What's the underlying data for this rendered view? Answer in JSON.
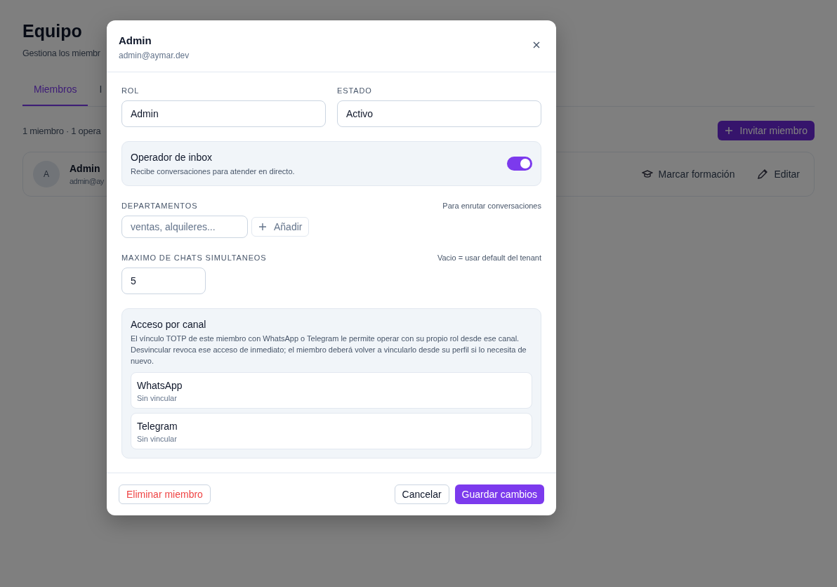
{
  "page": {
    "title": "Equipo",
    "subtitle": "Gestiona los miembr",
    "tabs": [
      {
        "label": "Miembros",
        "selected": true
      },
      {
        "label": "I",
        "selected": false
      }
    ],
    "summary": "1 miembro · 1 opera",
    "invite_button": "Invitar miembro",
    "member": {
      "avatar": "A",
      "name": "Admin",
      "email": "admin@ay",
      "actions": [
        "Marcar formación",
        "Editar"
      ]
    }
  },
  "dialog": {
    "title": "Admin",
    "subtitle": "admin@aymar.dev",
    "role": {
      "label": "ROL",
      "value": "Admin"
    },
    "status": {
      "label": "ESTADO",
      "value": "Activo"
    },
    "operator": {
      "title": "Operador de inbox",
      "description": "Recibe conversaciones para atender en directo.",
      "on": true
    },
    "departments": {
      "label": "DEPARTAMENTOS",
      "hint": "Para enrutar conversaciones",
      "placeholder": "ventas, alquileres...",
      "add_button": "Añadir"
    },
    "max_chats": {
      "label": "MAXIMO DE CHATS SIMULTANEOS",
      "hint": "Vacio = usar default del tenant",
      "value": "5"
    },
    "channels": {
      "title": "Acceso por canal",
      "description": "El vínculo TOTP de este miembro con WhatsApp o Telegram le permite operar con su propio rol desde ese canal. Desvincular revoca ese acceso de inmediato; el miembro deberá volver a vincularlo desde su perfil si lo necesita de nuevo.",
      "items": [
        {
          "name": "WhatsApp",
          "status": "Sin vincular"
        },
        {
          "name": "Telegram",
          "status": "Sin vincular"
        }
      ]
    },
    "footer": {
      "delete_button": "Eliminar miembro",
      "cancel_button": "Cancelar",
      "save_button": "Guardar cambios"
    }
  }
}
